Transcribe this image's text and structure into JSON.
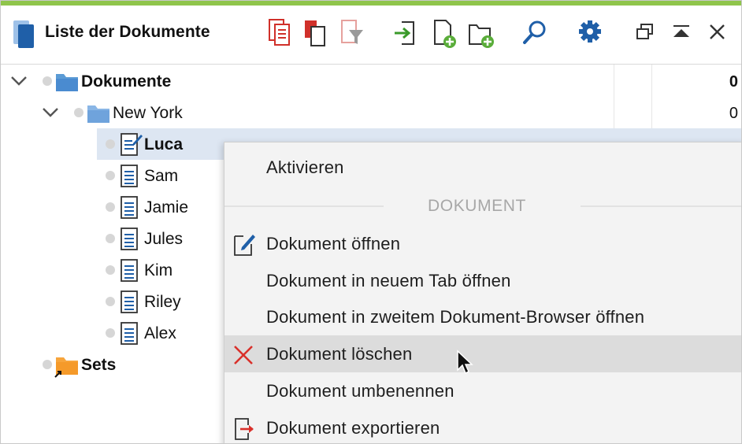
{
  "header": {
    "title": "Liste der Dokumente",
    "accent_color": "#8fc54b",
    "toolbar_icons": [
      "documents-icon",
      "copy-documents-icon",
      "filter-documents-icon",
      "import-icon",
      "new-document-icon",
      "new-folder-icon",
      "search-icon",
      "settings-icon",
      "undock-icon",
      "collapse-icon",
      "close-icon"
    ]
  },
  "tree": {
    "root": {
      "label": "Dokumente",
      "count": "0"
    },
    "folder": {
      "label": "New York",
      "count": "0"
    },
    "documents": [
      {
        "label": "Luca",
        "selected": true
      },
      {
        "label": "Sam"
      },
      {
        "label": "Jamie"
      },
      {
        "label": "Jules"
      },
      {
        "label": "Kim"
      },
      {
        "label": "Riley"
      },
      {
        "label": "Alex"
      }
    ],
    "sets": {
      "label": "Sets"
    }
  },
  "context_menu": {
    "activate": "Aktivieren",
    "section_title": "DOKUMENT",
    "items": [
      {
        "label": "Dokument öffnen",
        "icon": "edit-document-icon"
      },
      {
        "label": "Dokument in neuem Tab öffnen"
      },
      {
        "label": "Dokument in zweitem Dokument-Browser öffnen"
      },
      {
        "label": "Dokument löschen",
        "icon": "delete-x-icon",
        "highlighted": true
      },
      {
        "label": "Dokument umbenennen"
      },
      {
        "label": "Dokument exportieren",
        "icon": "export-icon"
      }
    ]
  }
}
